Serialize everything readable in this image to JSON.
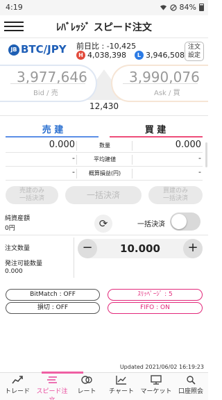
{
  "status_bar": {
    "time": "4:19",
    "battery": "84%"
  },
  "app_bar": {
    "title": "ﾚﾊﾞﾚｯｼﾞ スピード注文"
  },
  "symbol": {
    "icon_text": "JB",
    "name": "BTC/JPY",
    "change_label": "前日比 : -10,425",
    "high_badge": "H",
    "high": "4,038,398",
    "low_badge": "L",
    "low": "3,946,508",
    "settings_line1": "注文",
    "settings_line2": "設定"
  },
  "prices": {
    "bid": "3,977,646",
    "bid_label": "Bid / 売",
    "ask": "3,990,076",
    "ask_label": "Ask / 買",
    "spread": "12,430"
  },
  "tabs": {
    "sell": "売 建",
    "buy": "買 建"
  },
  "position_rows": [
    {
      "label": "数量",
      "sell": "0.000",
      "buy": "0.000"
    },
    {
      "label": "平均建値",
      "sell": "-",
      "buy": "-"
    },
    {
      "label": "概算損益(円)",
      "sell": "-",
      "buy": "-"
    }
  ],
  "settle_buttons": {
    "sell_only_1": "売建のみ",
    "sell_only_2": "一括決済",
    "bulk": "一括決済",
    "buy_only_1": "買建のみ",
    "buy_only_2": "一括決済"
  },
  "margin": {
    "label": "純資産額",
    "value": "0円"
  },
  "bulk_toggle_label": "一括決済",
  "order": {
    "qty_label": "注文数量",
    "qty_value": "10.000",
    "available_label": "発注可能数量",
    "available_value": "0.000",
    "minus": "−",
    "plus": "+"
  },
  "pills": {
    "bitmatch": "BitMatch : OFF",
    "slippage": "ｽﾘｯﾍﾟｰｼﾞ : 5",
    "stoploss": "損切 : OFF",
    "fifo": "FIFO : ON"
  },
  "updated": "Updated   2021/06/02  16:19:23",
  "nav": [
    {
      "label": "トレード",
      "icon": "trade-icon"
    },
    {
      "label": "スピード注文",
      "icon": "speed-order-icon"
    },
    {
      "label": "レート",
      "icon": "rate-icon"
    },
    {
      "label": "チャート",
      "icon": "chart-icon"
    },
    {
      "label": "マーケット",
      "icon": "market-icon"
    },
    {
      "label": "口座照会",
      "icon": "account-icon"
    }
  ],
  "colors": {
    "accent_blue": "#2a6fd0",
    "accent_pink": "#e2287a",
    "high_red": "#e24a3b",
    "low_blue": "#2c7be5"
  }
}
